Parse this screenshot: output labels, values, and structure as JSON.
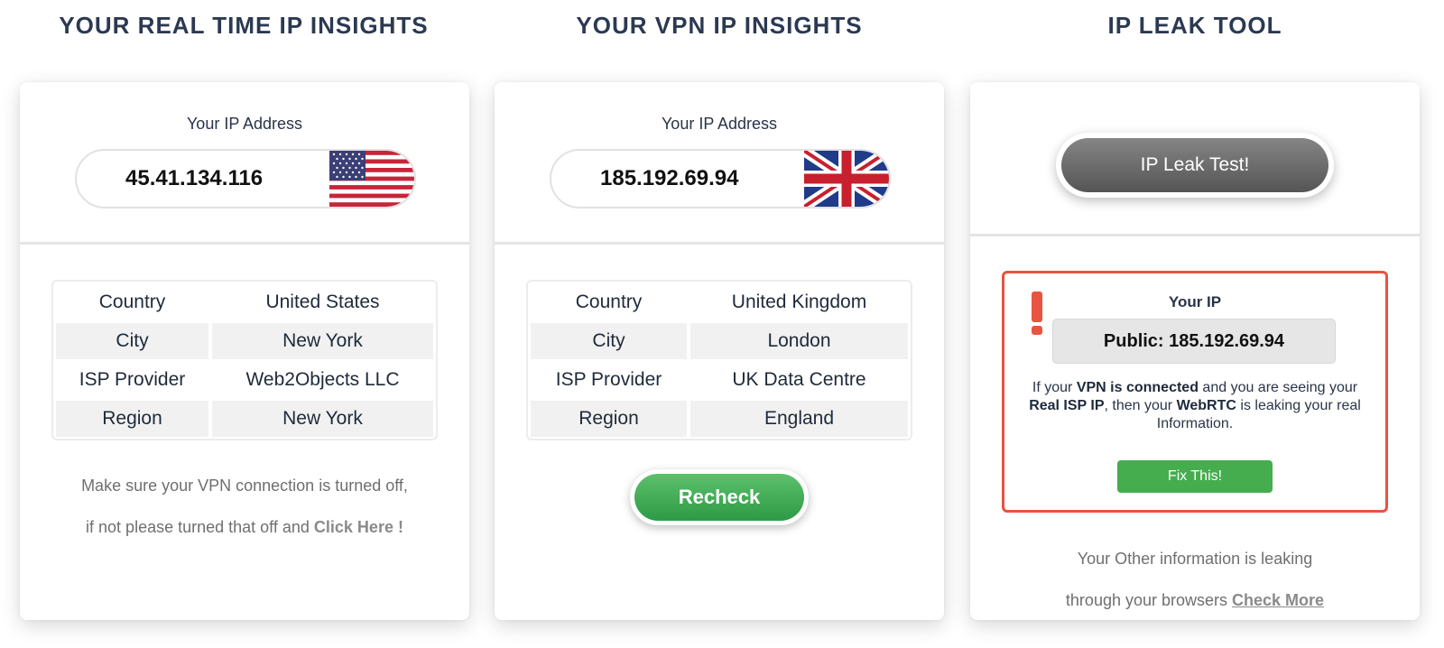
{
  "columns": [
    {
      "title": "YOUR REAL TIME IP INSIGHTS",
      "ip_label": "Your IP Address",
      "ip": "45.41.134.116",
      "flag": "us-flag-icon",
      "rows": [
        {
          "label": "Country",
          "value": "United States"
        },
        {
          "label": "City",
          "value": "New York"
        },
        {
          "label": "ISP Provider",
          "value": "Web2Objects LLC"
        },
        {
          "label": "Region",
          "value": "New York"
        }
      ],
      "note_line1": "Make sure your VPN connection is turned off,",
      "note_line2_prefix": "if not please turned that off and",
      "note_link": "Click Here !"
    },
    {
      "title": "YOUR VPN IP INSIGHTS",
      "ip_label": "Your IP Address",
      "ip": "185.192.69.94",
      "flag": "uk-flag-icon",
      "rows": [
        {
          "label": "Country",
          "value": "United Kingdom"
        },
        {
          "label": "City",
          "value": "London"
        },
        {
          "label": "ISP Provider",
          "value": "UK Data Centre"
        },
        {
          "label": "Region",
          "value": "England"
        }
      ],
      "button": "Recheck"
    },
    {
      "title": "IP LEAK TOOL",
      "button": "IP Leak Test!",
      "alert": {
        "title": "Your IP",
        "public": "Public: 185.192.69.94",
        "text_1": "If your",
        "text_vpn": "VPN is connected",
        "text_2": "and you are seeing your",
        "text_isp": "Real ISP IP",
        "text_3": ", then your",
        "text_webrtc": "WebRTC",
        "text_4": "is leaking your real Information.",
        "fix": "Fix This!"
      },
      "other_line1": "Your Other information is leaking",
      "other_line2_prefix": "through your browsers",
      "other_link": "Check More"
    }
  ],
  "colors": {
    "title": "#2b3952",
    "alert_border": "#e8543f",
    "recheck_green": "#3aa852",
    "fix_green": "#45ad4e",
    "leak_button_gray": "#6a6a6a"
  }
}
